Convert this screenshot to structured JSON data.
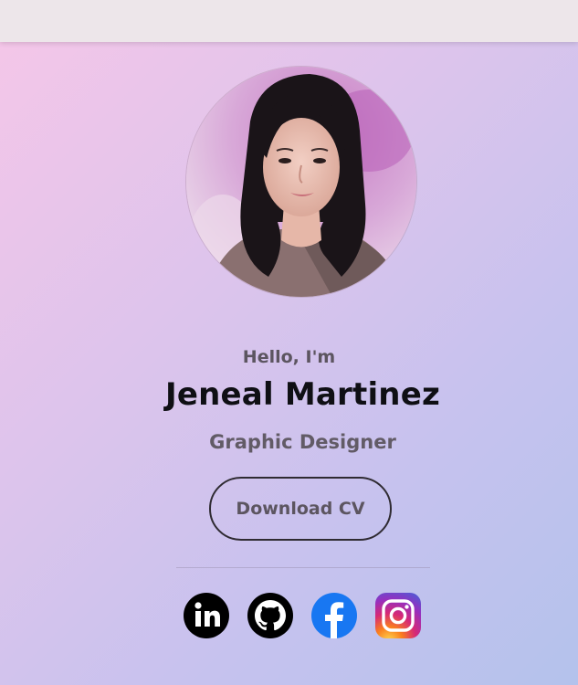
{
  "profile": {
    "greeting": "Hello, I'm",
    "name": "Jeneal Martinez",
    "role": "Graphic Designer",
    "avatar_alt": "Profile photo"
  },
  "actions": {
    "download_cv_label": "Download CV"
  },
  "social_links": [
    {
      "name": "LinkedIn",
      "icon": "linkedin-icon",
      "color": "#000000"
    },
    {
      "name": "GitHub",
      "icon": "github-icon",
      "color": "#000000"
    },
    {
      "name": "Facebook",
      "icon": "facebook-icon",
      "color": "#1877f2"
    },
    {
      "name": "Instagram",
      "icon": "instagram-icon",
      "color": "#e1306c"
    }
  ],
  "colors": {
    "background_start": "#f6c6e8",
    "background_end": "#b4c2ec",
    "text_primary": "#0f0f14",
    "text_secondary": "#5c5560"
  }
}
